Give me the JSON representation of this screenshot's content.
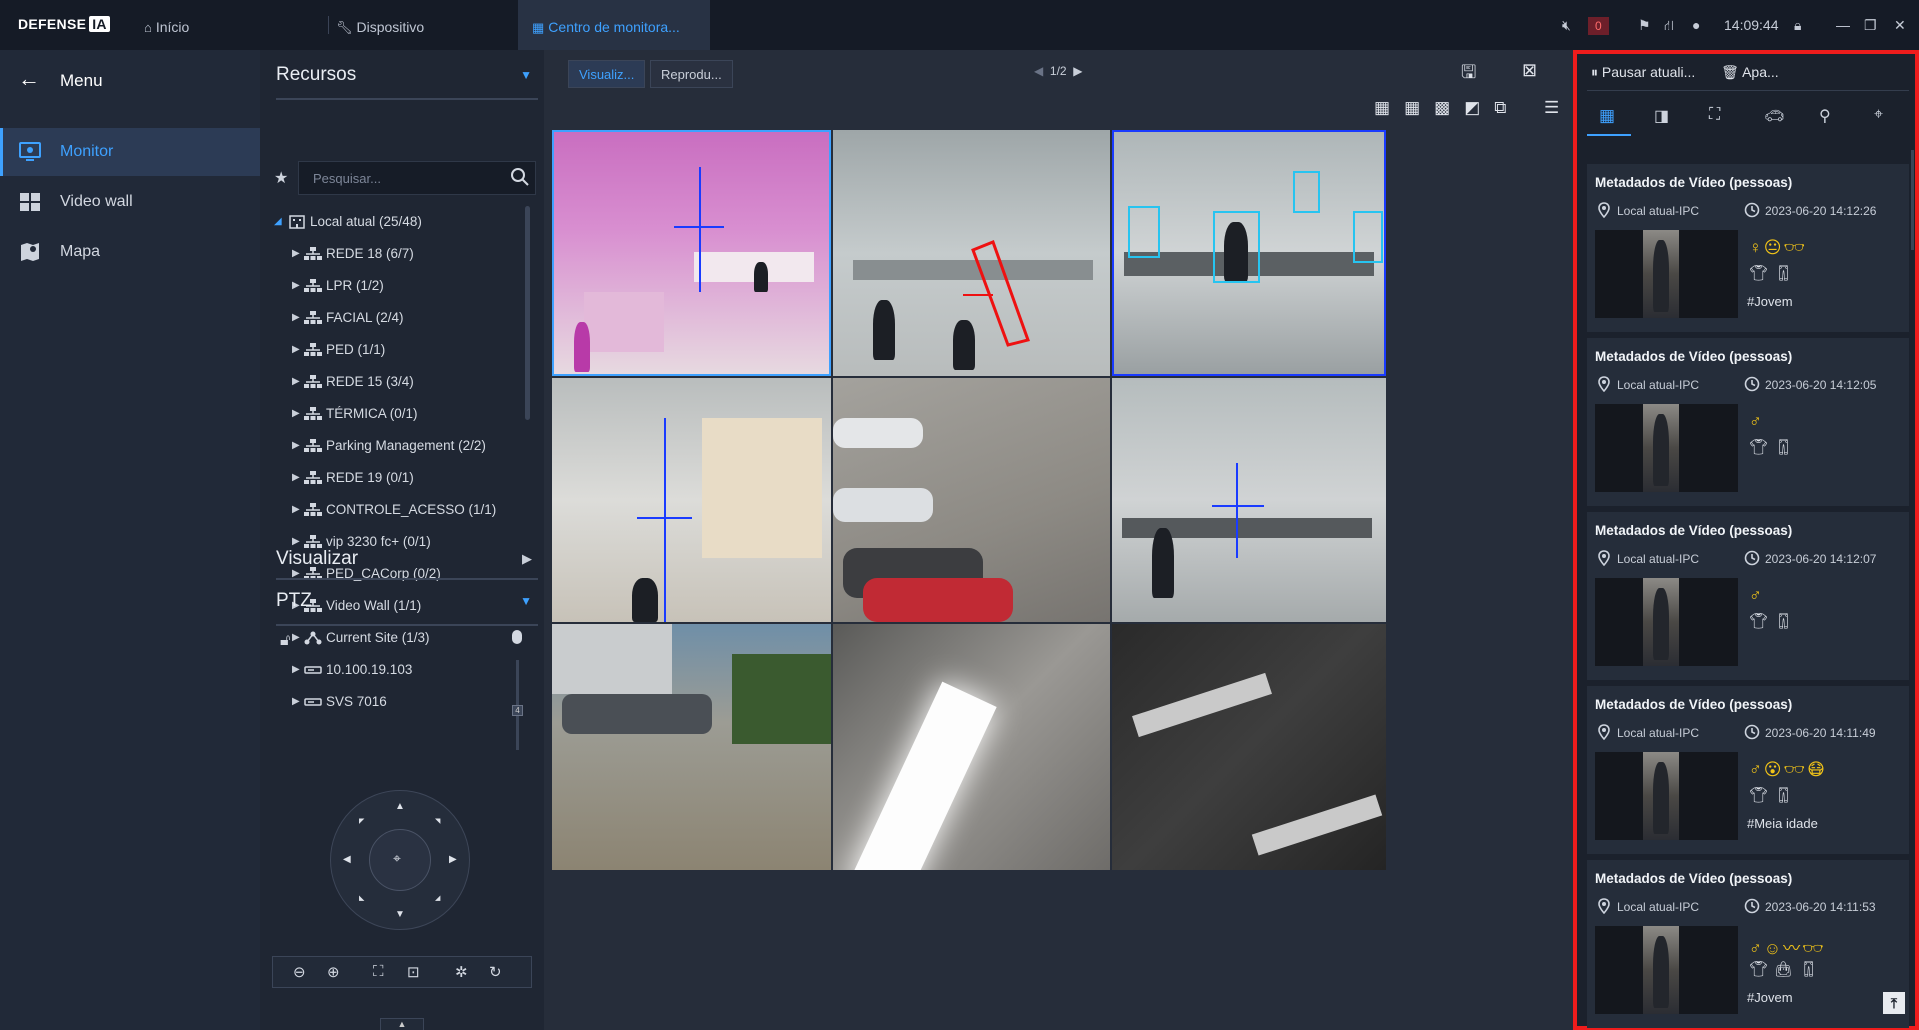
{
  "app": {
    "logo": "DEFENSE",
    "logo_badge": "IA"
  },
  "tabs": [
    {
      "label": "Início",
      "icon": "home-icon"
    },
    {
      "label": "Dispositivo",
      "icon": "wrench-icon"
    },
    {
      "label": "Centro de monitora...",
      "icon": "grid-icon"
    }
  ],
  "status": {
    "alarm_count": "0",
    "time": "14:09:44"
  },
  "nav": {
    "menu_label": "Menu",
    "items": [
      {
        "label": "Monitor",
        "icon": "monitor-icon",
        "active": true
      },
      {
        "label": "Video wall",
        "icon": "video-wall-icon",
        "active": false
      },
      {
        "label": "Mapa",
        "icon": "map-icon",
        "active": false
      }
    ]
  },
  "resources": {
    "title": "Recursos",
    "search_placeholder": "Pesquisar...",
    "tree_root": "Local atual (25/48)",
    "tree": [
      {
        "label": "REDE 18 (6/7)",
        "icon": "network-icon"
      },
      {
        "label": "LPR (1/2)",
        "icon": "network-icon"
      },
      {
        "label": "FACIAL (2/4)",
        "icon": "network-icon"
      },
      {
        "label": "PED (1/1)",
        "icon": "network-icon"
      },
      {
        "label": "REDE 15 (3/4)",
        "icon": "network-icon"
      },
      {
        "label": "TÉRMICA (0/1)",
        "icon": "network-icon"
      },
      {
        "label": "Parking Management (2/2)",
        "icon": "network-icon"
      },
      {
        "label": "REDE 19 (0/1)",
        "icon": "network-icon"
      },
      {
        "label": "CONTROLE_ACESSO (1/1)",
        "icon": "network-icon"
      },
      {
        "label": "vip 3230 fc+ (0/1)",
        "icon": "network-icon"
      },
      {
        "label": "PED_CACorp (0/2)",
        "icon": "network-icon"
      },
      {
        "label": "Video Wall (1/1)",
        "icon": "network-icon"
      },
      {
        "label": "Current Site (1/3)",
        "icon": "site-icon"
      },
      {
        "label": "10.100.19.103",
        "icon": "device-icon"
      },
      {
        "label": "SVS 7016",
        "icon": "device-icon"
      }
    ],
    "view_title": "Visualizar",
    "ptz_title": "PTZ"
  },
  "monitor": {
    "tab_live": "Visualiz...",
    "tab_playback": "Reprodu...",
    "page": "1/2"
  },
  "right_panel": {
    "pause_label": "Pausar atuali...",
    "clear_label": "Apa...",
    "cards": [
      {
        "title": "Metadados de Vídeo (pessoas)",
        "location": "Local atual-IPC",
        "datetime": "2023-06-20 14:12:26",
        "attributes": [
          "female",
          "neutral-face",
          "glasses"
        ],
        "clothing": [
          "top",
          "pants"
        ],
        "tag": "#Jovem"
      },
      {
        "title": "Metadados de Vídeo (pessoas)",
        "location": "Local atual-IPC",
        "datetime": "2023-06-20 14:12:05",
        "attributes": [
          "male"
        ],
        "clothing": [
          "top",
          "pants"
        ],
        "tag": ""
      },
      {
        "title": "Metadados de Vídeo (pessoas)",
        "location": "Local atual-IPC",
        "datetime": "2023-06-20 14:12:07",
        "attributes": [
          "male"
        ],
        "clothing": [
          "top",
          "pants"
        ],
        "tag": ""
      },
      {
        "title": "Metadados de Vídeo (pessoas)",
        "location": "Local atual-IPC",
        "datetime": "2023-06-20 14:11:49",
        "attributes": [
          "male",
          "surprised-face",
          "glasses",
          "mask"
        ],
        "clothing": [
          "top",
          "pants"
        ],
        "tag": "#Meia idade"
      },
      {
        "title": "Metadados de Vídeo (pessoas)",
        "location": "Local atual-IPC",
        "datetime": "2023-06-20 14:11:53",
        "attributes": [
          "male",
          "smile-face",
          "beard",
          "glasses"
        ],
        "clothing": [
          "top",
          "bag",
          "pants"
        ],
        "tag": "#Jovem"
      }
    ]
  },
  "colors": {
    "accent": "#3ea1ff",
    "highlight_border": "#ee1c1c",
    "attribute_yellow": "#f2c418"
  }
}
